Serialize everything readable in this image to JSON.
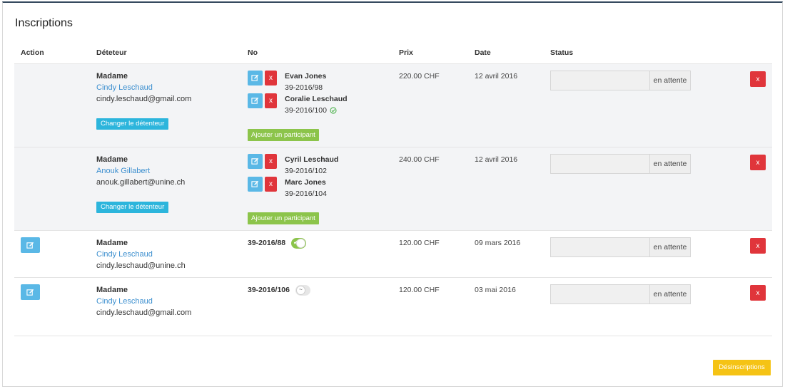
{
  "page": {
    "title": "Inscriptions"
  },
  "table": {
    "headers": {
      "action": "Action",
      "detenteur": "Déteteur",
      "no": "No",
      "prix": "Prix",
      "date": "Date",
      "status": "Status"
    }
  },
  "rows": [
    {
      "civility": "Madame",
      "name": "Cindy Leschaud",
      "email": "cindy.leschaud@gmail.com",
      "change_label": "Changer le détenteur",
      "participants": [
        {
          "name": "Evan Jones",
          "no": "39-2016/98"
        },
        {
          "name": "Coralie Leschaud",
          "no": "39-2016/100"
        }
      ],
      "add_label": "Ajouter un participant",
      "prix": "220.00 CHF",
      "date": "12 avril 2016",
      "status": "en attente",
      "delete_label": "x"
    },
    {
      "civility": "Madame",
      "name": "Anouk Gillabert",
      "email": "anouk.gillabert@unine.ch",
      "change_label": "Changer le détenteur",
      "participants": [
        {
          "name": "Cyril Leschaud",
          "no": "39-2016/102"
        },
        {
          "name": "Marc Jones",
          "no": "39-2016/104"
        }
      ],
      "add_label": "Ajouter un participant",
      "prix": "240.00 CHF",
      "date": "12 avril 2016",
      "status": "en attente",
      "delete_label": "x"
    },
    {
      "civility": "Madame",
      "name": "Cindy Leschaud",
      "email": "cindy.leschaud@unine.ch",
      "no": "39-2016/88",
      "toggle": "on",
      "prix": "120.00 CHF",
      "date": "09 mars 2016",
      "status": "en attente",
      "delete_label": "x"
    },
    {
      "civility": "Madame",
      "name": "Cindy Leschaud",
      "email": "cindy.leschaud@gmail.com",
      "no": "39-2016/106",
      "toggle": "off",
      "prix": "120.00 CHF",
      "date": "03 mai 2016",
      "status": "en attente",
      "delete_label": "x"
    }
  ],
  "footer": {
    "desinscriptions_label": "Désinscriptions"
  },
  "colors": {
    "info": "#2cb5dc",
    "success": "#8cc44b",
    "danger": "#e0353b",
    "warning": "#f5c315",
    "edit": "#5ab8e6",
    "link": "#3c8fcf"
  },
  "icons": {
    "edit": "pencil-square-icon",
    "verified": "check-circle-icon",
    "toggle_on": "checkmark-icon",
    "toggle_off": "dash-icon"
  }
}
